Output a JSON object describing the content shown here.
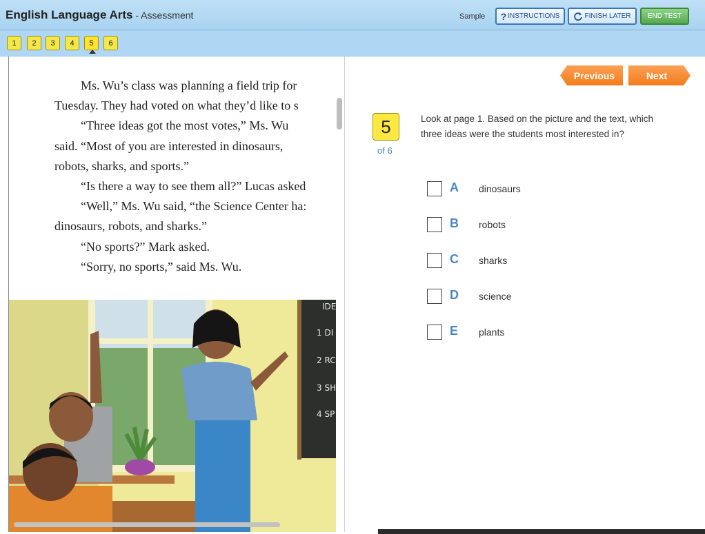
{
  "header": {
    "app_title": "English Language Arts",
    "app_subtitle": " - Assessment",
    "sample_label": "Sample",
    "instructions_label": "INSTRUCTIONS",
    "finish_later_label": "FINISH LATER",
    "end_test_label": "END TEST"
  },
  "question_nav": {
    "items": [
      "1",
      "2",
      "3",
      "4",
      "5",
      "6"
    ],
    "current": "5"
  },
  "passage": {
    "lines": [
      "Ms. Wu’s class was planning a field trip for",
      "Tuesday. They had voted on what they’d like to s",
      "“Three ideas got the most votes,” Ms. Wu",
      "said. “Most of you are interested in dinosaurs,",
      "robots, sharks, and sports.”",
      "“Is there a way to see them all?” Lucas asked",
      "“Well,” Ms. Wu said, “the Science Center ha:",
      "dinosaurs, robots, and sharks.”",
      "“No sports?” Mark asked.",
      "“Sorry, no sports,” said Ms. Wu."
    ],
    "chalkboard": [
      "IDE",
      "1 DI",
      "2 RC",
      "3 SH",
      "4 SP"
    ]
  },
  "navigation": {
    "previous_label": "Previous",
    "next_label": "Next"
  },
  "question": {
    "number": "5",
    "of_label": "of 6",
    "prompt": "Look at page 1. Based on the picture and the text, which three ideas were the students most interested in?",
    "options": [
      {
        "letter": "A",
        "text": "dinosaurs"
      },
      {
        "letter": "B",
        "text": "robots"
      },
      {
        "letter": "C",
        "text": "sharks"
      },
      {
        "letter": "D",
        "text": "science"
      },
      {
        "letter": "E",
        "text": "plants"
      }
    ]
  },
  "colors": {
    "header_bg": "#afd6f3",
    "question_badge": "#fde83f",
    "nav_button": "#f58a2c",
    "option_letter": "#4b87c6",
    "end_test": "#54a94f"
  }
}
